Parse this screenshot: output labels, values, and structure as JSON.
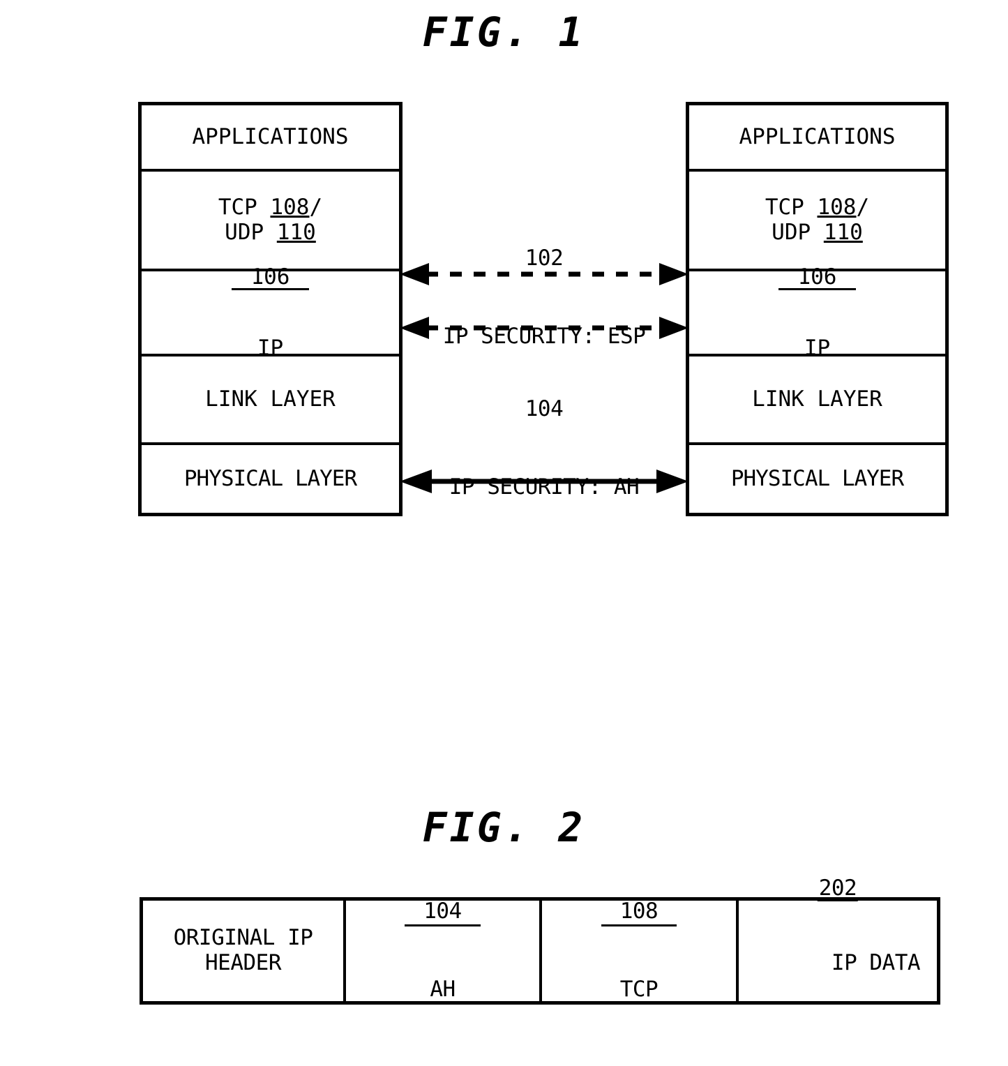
{
  "figures": {
    "fig1": {
      "title": "FIG. 1",
      "left_stack": {
        "name": "protocol-stack-left",
        "layers": [
          {
            "id": "applications",
            "label": "APPLICATIONS"
          },
          {
            "id": "transport",
            "line1_prefix": "TCP ",
            "line1_ref": "108",
            "line1_suffix": "/",
            "line2_prefix": "UDP ",
            "line2_ref": "110"
          },
          {
            "id": "ip",
            "ref": "106",
            "label": "IP"
          },
          {
            "id": "link",
            "label": "LINK LAYER"
          },
          {
            "id": "physical",
            "label": "PHYSICAL LAYER"
          }
        ]
      },
      "right_stack": {
        "name": "protocol-stack-right",
        "layers": [
          {
            "id": "applications",
            "label": "APPLICATIONS"
          },
          {
            "id": "transport",
            "line1_prefix": "TCP ",
            "line1_ref": "108",
            "line1_suffix": "/",
            "line2_prefix": "UDP ",
            "line2_ref": "110"
          },
          {
            "id": "ip",
            "ref": "106",
            "label": "IP"
          },
          {
            "id": "link",
            "label": "LINK LAYER"
          },
          {
            "id": "physical",
            "label": "PHYSICAL LAYER"
          }
        ]
      },
      "connectors": [
        {
          "id": "esp",
          "ref": "102",
          "label": "IP SECURITY: ESP",
          "style": "dashed",
          "arrows": "both"
        },
        {
          "id": "ah",
          "ref": "104",
          "label": "IP SECURITY: AH",
          "style": "dashed",
          "arrows": "both"
        },
        {
          "id": "physical-link",
          "ref": "",
          "label": "",
          "style": "solid",
          "arrows": "both"
        }
      ]
    },
    "fig2": {
      "title": "FIG. 2",
      "packet_cells": [
        {
          "id": "original-ip-header",
          "line1": "ORIGINAL IP",
          "line2": "HEADER",
          "ref": ""
        },
        {
          "id": "ah",
          "ref": "104",
          "label": "AH"
        },
        {
          "id": "tcp",
          "ref": "108",
          "label": "TCP"
        },
        {
          "id": "ip-data",
          "ref": "202",
          "label": "IP DATA"
        }
      ]
    }
  },
  "colors": {
    "ink": "#000000",
    "paper": "#ffffff"
  }
}
